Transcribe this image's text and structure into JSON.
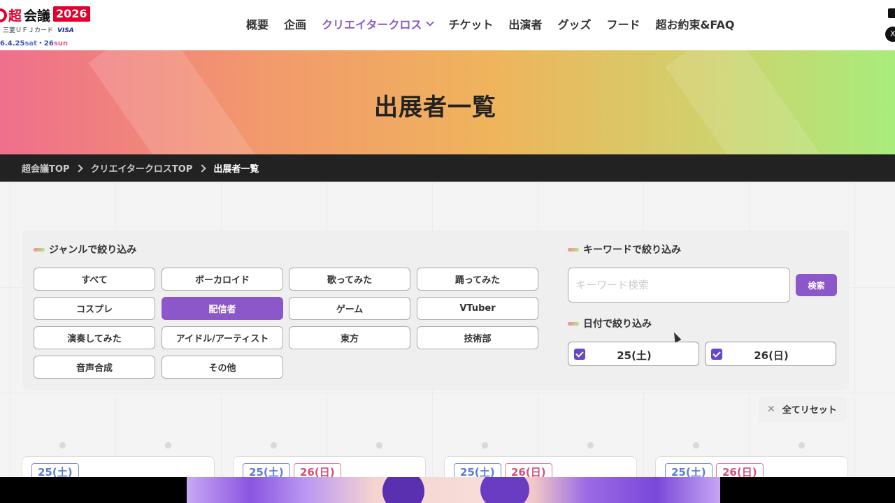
{
  "logo": {
    "chou": "超",
    "kaigi": "会議",
    "year": "2026",
    "sponsor": "三菱ＵＦＪカード",
    "sponsor_brand": "VISA",
    "date_prefix": "6.4.25",
    "sat": "sat",
    "mid": "・26",
    "sun": "sun"
  },
  "nav": [
    {
      "label": "概要"
    },
    {
      "label": "企画"
    },
    {
      "label": "クリエイタークロス"
    },
    {
      "label": "チケット"
    },
    {
      "label": "出演者"
    },
    {
      "label": "グッズ"
    },
    {
      "label": "フード"
    },
    {
      "label": "超お約束&FAQ"
    }
  ],
  "header_social": "X",
  "hero": {
    "title": "出展者一覧"
  },
  "breadcrumb": [
    "超会議TOP",
    "クリエイタークロスTOP",
    "出展者一覧"
  ],
  "filters": {
    "genre_title": "ジャンルで絞り込み",
    "genres": [
      "すべて",
      "ボーカロイド",
      "歌ってみた",
      "踊ってみた",
      "コスプレ",
      "配信者",
      "ゲーム",
      "VTuber",
      "演奏してみた",
      "アイドル/アーティスト",
      "東方",
      "技術部",
      "音声合成",
      "その他"
    ],
    "selected_genre": "配信者",
    "keyword_title": "キーワードで絞り込み",
    "keyword_placeholder": "キーワード検索",
    "keyword_value": "",
    "search_label": "検索",
    "date_title": "日付で絞り込み",
    "dates": [
      {
        "label": "25(土)",
        "checked": true
      },
      {
        "label": "26(日)",
        "checked": true
      }
    ],
    "reset_label": "全てリセット"
  },
  "cards": [
    {
      "tags": [
        "25(土)"
      ]
    },
    {
      "tags": [
        "25(土)",
        "26(日)"
      ]
    },
    {
      "tags": [
        "25(土)",
        "26(日)"
      ]
    },
    {
      "tags": [
        "25(土)",
        "26(日)"
      ]
    }
  ],
  "colors": {
    "accent": "#8c57c9",
    "checkbox": "#6547c8",
    "sat": "#5b7bd6",
    "sun": "#d34f79"
  }
}
